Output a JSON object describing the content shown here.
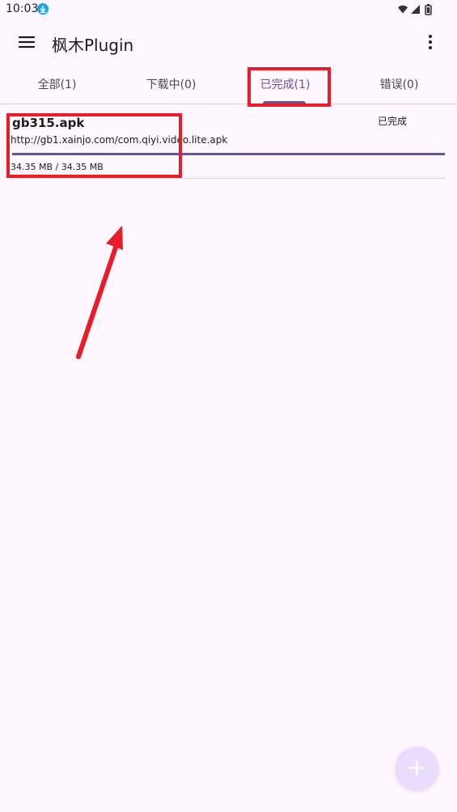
{
  "status_bar": {
    "time": "10:03"
  },
  "app_bar": {
    "title": "枫木Plugin"
  },
  "tabs": [
    {
      "label": "全部(1)"
    },
    {
      "label": "下载中(0)"
    },
    {
      "label": "已完成(1)"
    },
    {
      "label": "错误(0)"
    }
  ],
  "selected_tab": "已完成(1)",
  "download_item": {
    "file_name": "gb315.apk",
    "url": "http://gb1.xainjo.com/com.qiyi.video.lite.apk",
    "status": "已完成",
    "size": "34.35 MB / 34.35 MB",
    "progress_percent": 100
  },
  "icons": {
    "menu": "menu-icon",
    "more": "more-vert-icon",
    "add": "plus-icon",
    "download_status": "download-status-icon",
    "wifi": "wifi-icon",
    "signal": "signal-icon",
    "battery": "battery-icon"
  },
  "colors": {
    "background": "#fef7ff",
    "accent": "#6750a4",
    "fab": "#e8ddff",
    "annotation": "#e91d2a"
  }
}
